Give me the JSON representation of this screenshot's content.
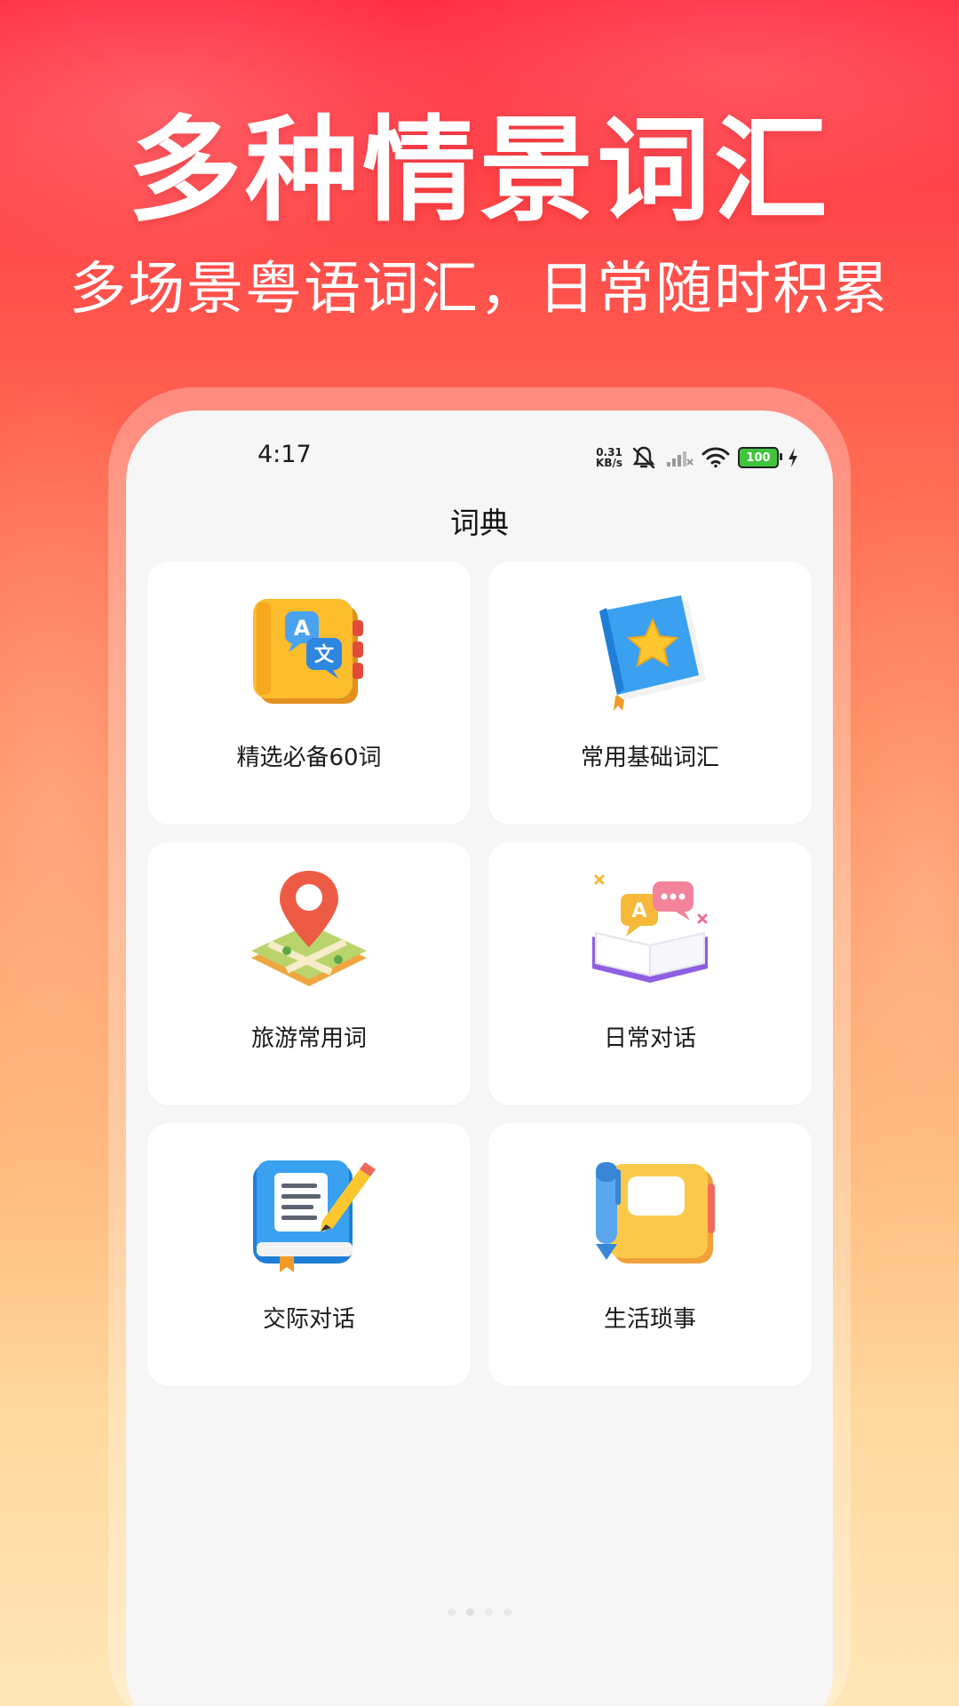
{
  "banner": {
    "headline": "多种情景词汇",
    "subline": "多场景粤语词汇，日常随时积累"
  },
  "status_bar": {
    "time": "4:17",
    "net_speed_value": "0.31",
    "net_speed_unit": "KB/s",
    "battery": "100",
    "icons": [
      "mute-icon",
      "signal-icon",
      "wifi-icon",
      "battery-icon",
      "charging-icon"
    ]
  },
  "screen": {
    "title": "词典",
    "categories": [
      {
        "label": "精选必备60词",
        "icon": "translate-book-icon"
      },
      {
        "label": "常用基础词汇",
        "icon": "star-book-icon"
      },
      {
        "label": "旅游常用词",
        "icon": "map-pin-icon"
      },
      {
        "label": "日常对话",
        "icon": "chat-book-icon"
      },
      {
        "label": "交际对话",
        "icon": "notebook-pencil-icon"
      },
      {
        "label": "生活琐事",
        "icon": "notebook-pen-icon"
      }
    ]
  },
  "pagination": {
    "count": 4,
    "active_index": 1
  },
  "colors": {
    "background_top": "#ff2f45",
    "background_bottom": "#ffe6b8",
    "card": "#ffffff",
    "screen": "#f6f6f7"
  }
}
